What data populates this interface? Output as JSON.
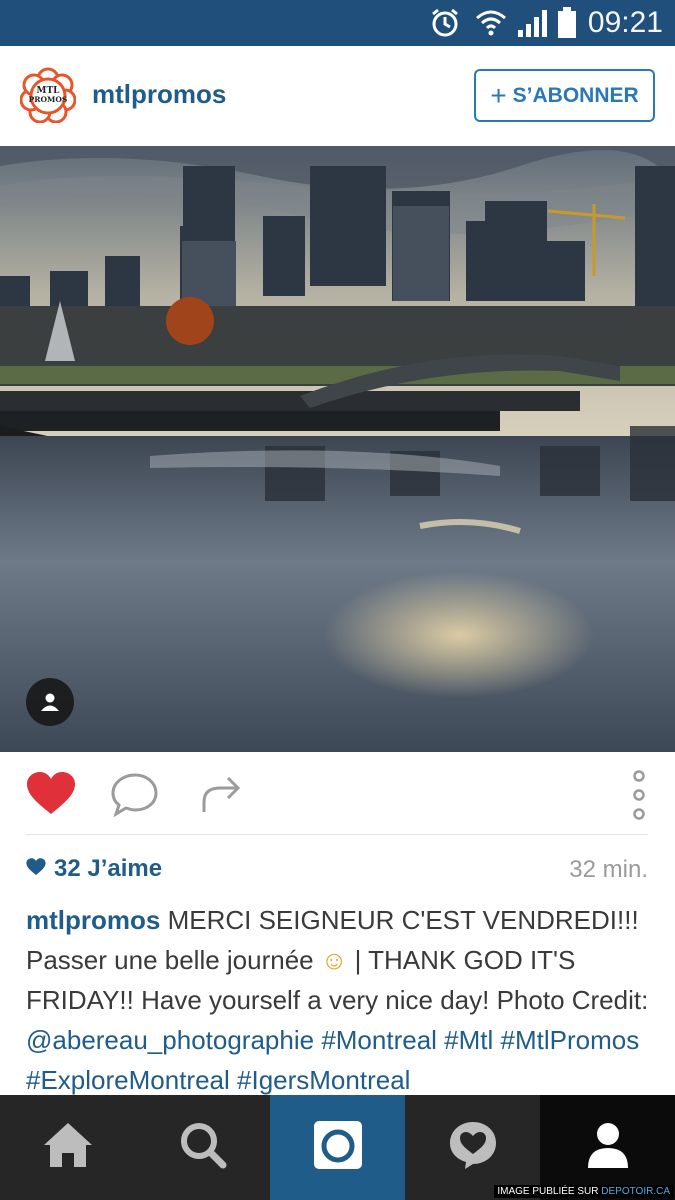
{
  "status_bar": {
    "time": "09:21",
    "icons": [
      "alarm-icon",
      "wifi-icon",
      "signal-icon",
      "battery-icon"
    ],
    "background": "#1f4f7a"
  },
  "post_header": {
    "logo_text_line1": "MTL",
    "logo_text_line2": "PROMOS",
    "username": "mtlpromos",
    "follow_label": "S’ABONNER",
    "follow_icon": "plus-icon"
  },
  "photo": {
    "tag_icon": "person-icon"
  },
  "actions": {
    "like_icon": "heart-icon",
    "comment_icon": "comment-icon",
    "share_icon": "share-icon",
    "more_icon": "more-vertical-icon"
  },
  "likes": {
    "label": "32 J’aime",
    "time_ago": "32 min."
  },
  "caption": {
    "username": "mtlpromos",
    "text_1": " MERCI SEIGNEUR C'EST VENDREDI!!! Passer une belle journée ",
    "emoji": "☺",
    "text_2": " | THANK GOD IT'S FRIDAY!! Have yourself a very nice day! Photo Credit: ",
    "mention": "@abereau_photographie",
    "hashtags": [
      "#Montreal",
      "#Mtl",
      "#MtlPromos",
      "#ExploreMontreal",
      "#IgersMontreal"
    ]
  },
  "bottom_nav": {
    "items": [
      {
        "name": "home",
        "icon": "home-icon"
      },
      {
        "name": "search",
        "icon": "search-icon"
      },
      {
        "name": "camera",
        "icon": "camera-icon"
      },
      {
        "name": "activity",
        "icon": "activity-heart-icon"
      },
      {
        "name": "profile",
        "icon": "profile-icon"
      }
    ],
    "active_index": 2
  },
  "watermark": {
    "prefix": "IMAGE PUBLIÉE SUR ",
    "site": "DEPOTOIR.CA"
  },
  "colors": {
    "brand_blue": "#1f5c8a",
    "follow_border": "#2b78b8",
    "like_red": "#e0303a",
    "nav_bg": "#262626"
  }
}
